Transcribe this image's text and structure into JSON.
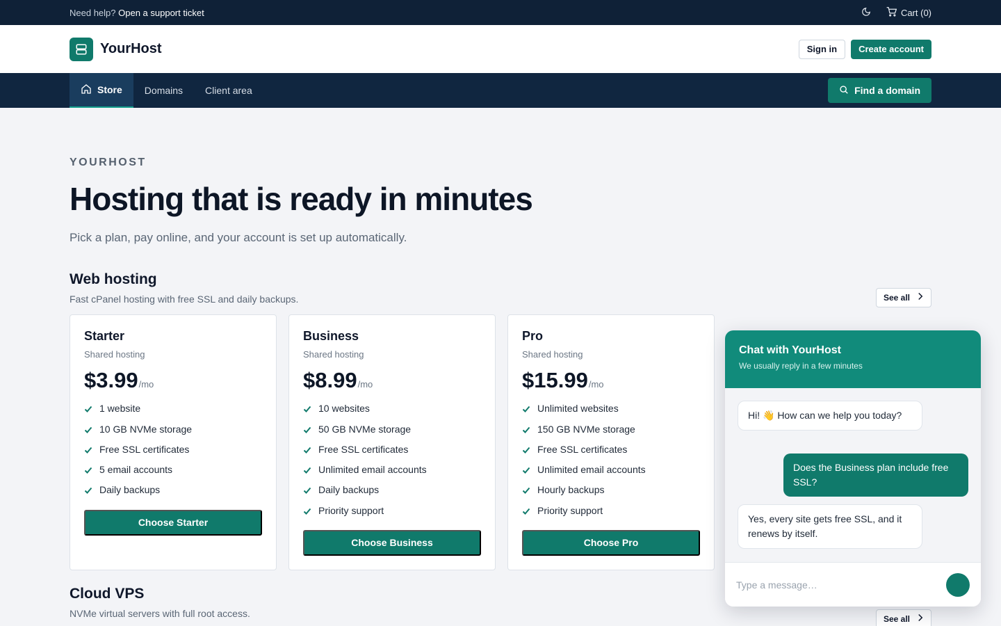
{
  "topbar": {
    "help_prefix": "Need help?",
    "help_link": "Open a support ticket",
    "cart_label": "Cart (0)",
    "icons": [
      "moon-icon",
      "cart-icon"
    ]
  },
  "header": {
    "brand": "YourHost",
    "sign_in": "Sign in",
    "create_account": "Create account"
  },
  "nav": {
    "items": [
      {
        "label": "Store",
        "active": true
      },
      {
        "label": "Domains",
        "active": false
      },
      {
        "label": "Client area",
        "active": false
      }
    ],
    "cta": "Find a domain"
  },
  "hero": {
    "eyebrow": "YOURHOST",
    "title": "Hosting that is ready in minutes",
    "subtitle": "Pick a plan, pay online, and your account is set up automatically."
  },
  "web_hosting": {
    "title": "Web hosting",
    "subtitle": "Fast cPanel hosting with free SSL and daily backups.",
    "see_all": "See all",
    "plans": [
      {
        "name": "Starter",
        "type": "Shared hosting",
        "price": "$3.99",
        "unit": "/mo",
        "features": [
          "1 website",
          "10 GB NVMe storage",
          "Free SSL certificates",
          "5 email accounts",
          "Daily backups"
        ],
        "button": "Choose Starter"
      },
      {
        "name": "Business",
        "type": "Shared hosting",
        "price": "$8.99",
        "unit": "/mo",
        "features": [
          "10 websites",
          "50 GB NVMe storage",
          "Free SSL certificates",
          "Unlimited email accounts",
          "Daily backups",
          "Priority support"
        ],
        "button": "Choose Business"
      },
      {
        "name": "Pro",
        "type": "Shared hosting",
        "price": "$15.99",
        "unit": "/mo",
        "features": [
          "Unlimited websites",
          "150 GB NVMe storage",
          "Free SSL certificates",
          "Unlimited email accounts",
          "Hourly backups",
          "Priority support"
        ],
        "button": "Choose Pro"
      }
    ]
  },
  "cloud_vps": {
    "title": "Cloud VPS",
    "subtitle": "NVMe virtual servers with full root access.",
    "see_all": "See all"
  },
  "chat": {
    "title": "Chat with YourHost",
    "status": "We usually reply in a few minutes",
    "messages": [
      {
        "from": "agent",
        "text": "Hi! 👋 How can we help you today?"
      },
      {
        "from": "user",
        "text": "Does the Business plan include free SSL?"
      },
      {
        "from": "agent",
        "text": "Yes, every site gets free SSL, and it renews by itself."
      }
    ],
    "input_placeholder": "Type a message…"
  },
  "colors": {
    "brand": "#107a6b",
    "topbar": "#0f2137",
    "nav": "#102640",
    "page_bg": "#f3f4f7"
  }
}
